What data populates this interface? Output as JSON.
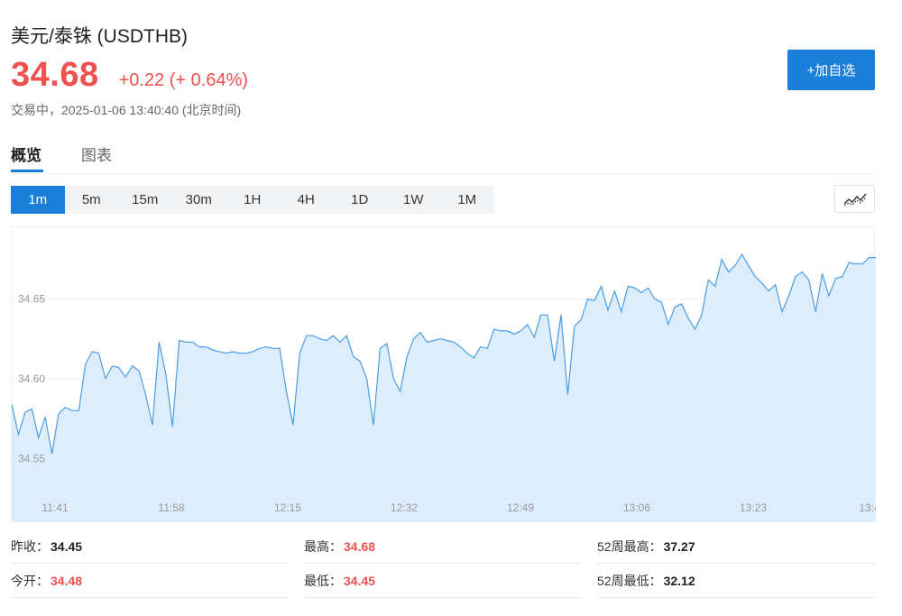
{
  "header": {
    "title": "美元/泰铢 (USDTHB)",
    "price": "34.68",
    "change": "+0.22 (+ 0.64%)",
    "status": "交易中，2025-01-06 13:40:40 (北京时间)",
    "add_button": "+加自选"
  },
  "tabs": [
    {
      "label": "概览",
      "active": true
    },
    {
      "label": "图表",
      "active": false
    }
  ],
  "intervals": [
    {
      "label": "1m",
      "active": true
    },
    {
      "label": "5m",
      "active": false
    },
    {
      "label": "15m",
      "active": false
    },
    {
      "label": "30m",
      "active": false
    },
    {
      "label": "1H",
      "active": false
    },
    {
      "label": "4H",
      "active": false
    },
    {
      "label": "1D",
      "active": false
    },
    {
      "label": "1W",
      "active": false
    },
    {
      "label": "1M",
      "active": false
    }
  ],
  "chart_toggle_icon": "line-chart-icon",
  "colors": {
    "accent": "#1b7ed8",
    "up": "#f0504f",
    "line": "#4a9de6",
    "area": "#deedfb"
  },
  "chart_data": {
    "type": "area",
    "x_ticks": [
      "11:41",
      "11:58",
      "12:15",
      "12:32",
      "12:49",
      "13:06",
      "13:23",
      "13:4"
    ],
    "y_ticks": [
      "34.55",
      "34.60",
      "34.65"
    ],
    "ylim": [
      34.51,
      34.695
    ],
    "values": [
      34.584,
      34.565,
      34.579,
      34.581,
      34.563,
      34.576,
      34.553,
      34.578,
      34.582,
      34.58,
      34.58,
      34.609,
      34.617,
      34.616,
      34.6,
      34.608,
      34.607,
      34.601,
      34.608,
      34.605,
      34.59,
      34.571,
      34.623,
      34.603,
      34.57,
      34.624,
      34.623,
      34.623,
      34.62,
      34.62,
      34.618,
      34.617,
      34.616,
      34.617,
      34.616,
      34.616,
      34.617,
      34.619,
      34.62,
      34.619,
      34.619,
      34.592,
      34.571,
      34.616,
      34.627,
      34.627,
      34.625,
      34.624,
      34.627,
      34.623,
      34.627,
      34.614,
      34.611,
      34.6,
      34.571,
      34.619,
      34.622,
      34.6,
      34.592,
      34.614,
      34.625,
      34.629,
      34.623,
      34.624,
      34.625,
      34.624,
      34.623,
      34.62,
      34.616,
      34.613,
      34.62,
      34.619,
      34.631,
      34.63,
      34.63,
      34.628,
      34.63,
      34.634,
      34.626,
      34.64,
      34.64,
      34.611,
      34.64,
      34.59,
      34.633,
      34.637,
      34.65,
      34.649,
      34.658,
      34.643,
      34.655,
      34.642,
      34.658,
      34.657,
      34.654,
      34.657,
      34.65,
      34.648,
      34.634,
      34.645,
      34.647,
      34.638,
      34.631,
      34.64,
      34.662,
      34.658,
      34.675,
      34.667,
      34.671,
      34.678,
      34.671,
      34.664,
      34.66,
      34.655,
      34.659,
      34.642,
      34.652,
      34.664,
      34.667,
      34.662,
      34.642,
      34.666,
      34.652,
      34.663,
      34.664,
      34.673,
      34.672,
      34.672,
      34.676,
      34.676
    ]
  },
  "stats": [
    {
      "label": "昨收：",
      "value": "34.45",
      "red": false
    },
    {
      "label": "最高：",
      "value": "34.68",
      "red": true
    },
    {
      "label": "52周最高：",
      "value": "37.27",
      "red": false
    },
    {
      "label": "今开：",
      "value": "34.48",
      "red": true
    },
    {
      "label": "最低：",
      "value": "34.45",
      "red": true
    },
    {
      "label": "52周最低：",
      "value": "32.12",
      "red": false
    }
  ]
}
